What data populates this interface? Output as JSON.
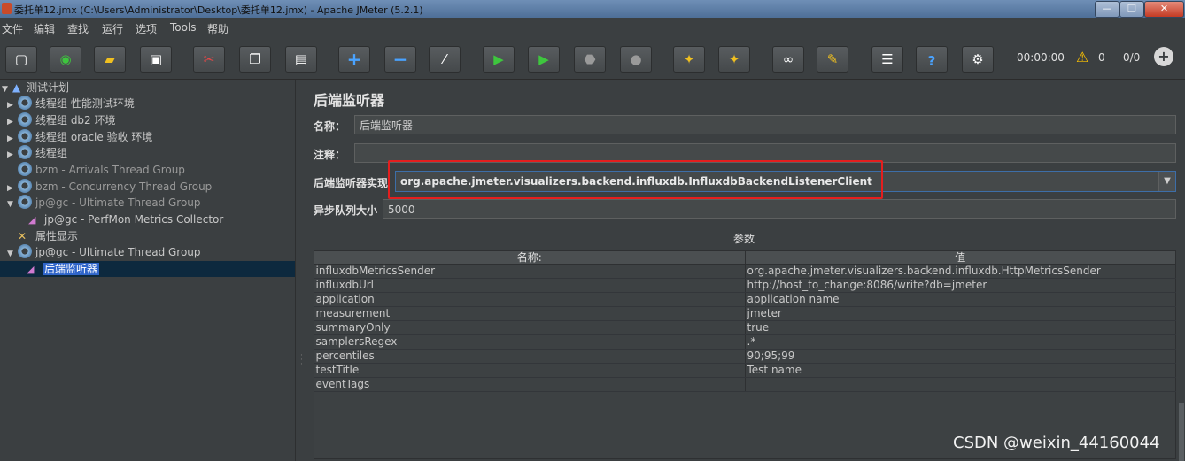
{
  "window": {
    "title": "委托单12.jmx (C:\\Users\\Administrator\\Desktop\\委托单12.jmx) - Apache JMeter (5.2.1)",
    "min_label": "—",
    "max_label": "❐",
    "close_label": "✕"
  },
  "menu": [
    "文件",
    "编辑",
    "查找",
    "运行",
    "选项",
    "Tools",
    "帮助"
  ],
  "toolbar": {
    "timer": "00:00:00",
    "warnings": "0",
    "ratio": "0/0"
  },
  "tree": [
    {
      "label": "测试计划"
    },
    {
      "label": "线程组 性能测试环境"
    },
    {
      "label": "线程组 db2 环境"
    },
    {
      "label": "线程组 oracle 验收 环境"
    },
    {
      "label": "线程组"
    },
    {
      "label": "bzm - Arrivals Thread Group"
    },
    {
      "label": "bzm - Concurrency Thread Group"
    },
    {
      "label": "jp@gc - Ultimate Thread Group"
    },
    {
      "label": "jp@gc - PerfMon Metrics Collector"
    },
    {
      "label": "属性显示"
    },
    {
      "label": "jp@gc - Ultimate Thread Group"
    },
    {
      "label": "后端监听器"
    }
  ],
  "panel": {
    "title": "后端监听器",
    "name_label": "名称：",
    "name_value": "后端监听器",
    "comment_label": "注释：",
    "comment_value": "",
    "impl_label": "后端监听器实现",
    "impl_value": "org.apache.jmeter.visualizers.backend.influxdb.InfluxdbBackendListenerClient",
    "queue_label": "异步队列大小",
    "queue_value": "5000",
    "params_label": "参数",
    "col_name": "名称:",
    "col_value": "值",
    "params": [
      {
        "name": "influxdbMetricsSender",
        "value": "org.apache.jmeter.visualizers.backend.influxdb.HttpMetricsSender"
      },
      {
        "name": "influxdbUrl",
        "value": "http://host_to_change:8086/write?db=jmeter"
      },
      {
        "name": "application",
        "value": "application name"
      },
      {
        "name": "measurement",
        "value": "jmeter"
      },
      {
        "name": "summaryOnly",
        "value": "true"
      },
      {
        "name": "samplersRegex",
        "value": ".*"
      },
      {
        "name": "percentiles",
        "value": "90;95;99"
      },
      {
        "name": "testTitle",
        "value": "Test name"
      },
      {
        "name": "eventTags",
        "value": ""
      }
    ]
  },
  "watermark": "CSDN @weixin_44160044"
}
